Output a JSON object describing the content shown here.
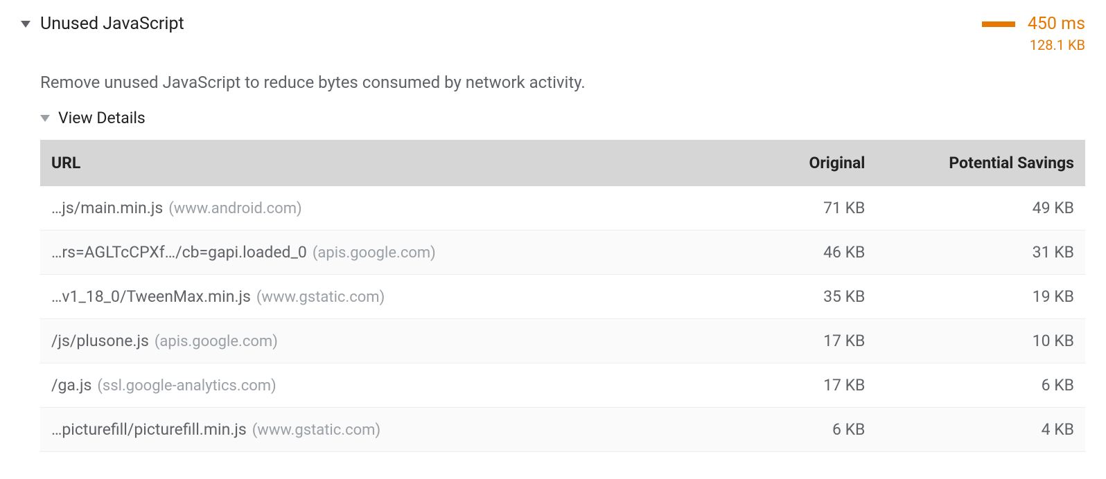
{
  "audit": {
    "title": "Unused JavaScript",
    "description": "Remove unused JavaScript to reduce bytes consumed by network activity.",
    "time": "450 ms",
    "size": "128.1 KB"
  },
  "details": {
    "label": "View Details",
    "columns": {
      "url": "URL",
      "original": "Original",
      "savings": "Potential Savings"
    },
    "rows": [
      {
        "path": "…js/main.min.js",
        "domain": "(www.android.com)",
        "original": "71 KB",
        "savings": "49 KB"
      },
      {
        "path": "…rs=AGLTcCPXf…/cb=gapi.loaded_0",
        "domain": "(apis.google.com)",
        "original": "46 KB",
        "savings": "31 KB"
      },
      {
        "path": "…v1_18_0/TweenMax.min.js",
        "domain": "(www.gstatic.com)",
        "original": "35 KB",
        "savings": "19 KB"
      },
      {
        "path": "/js/plusone.js",
        "domain": "(apis.google.com)",
        "original": "17 KB",
        "savings": "10 KB"
      },
      {
        "path": "/ga.js",
        "domain": "(ssl.google-analytics.com)",
        "original": "17 KB",
        "savings": "6 KB"
      },
      {
        "path": "…picturefill/picturefill.min.js",
        "domain": "(www.gstatic.com)",
        "original": "6 KB",
        "savings": "4 KB"
      }
    ]
  }
}
